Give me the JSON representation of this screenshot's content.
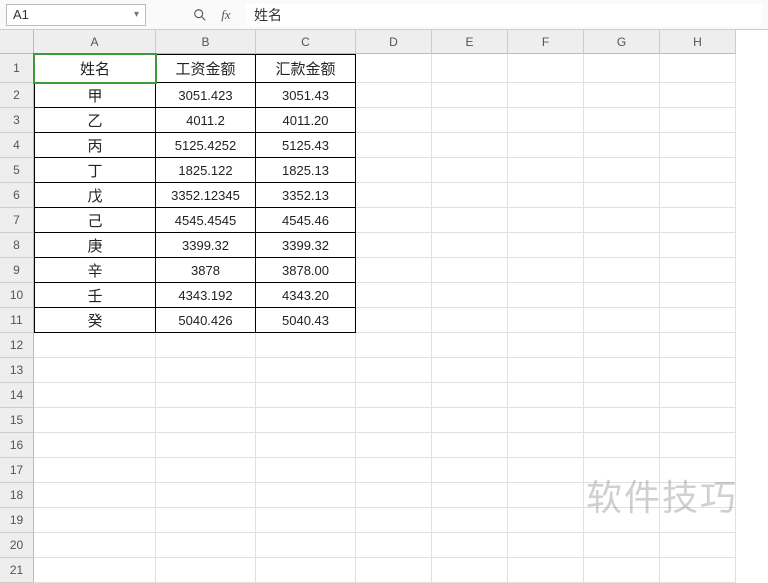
{
  "nameBox": "A1",
  "formula": "姓名",
  "columns": [
    "A",
    "B",
    "C",
    "D",
    "E",
    "F",
    "G",
    "H"
  ],
  "rowCount": 21,
  "activeCell": {
    "row": 1,
    "col": 0
  },
  "headers": [
    "姓名",
    "工资金额",
    "汇款金额"
  ],
  "table": [
    {
      "name": "甲",
      "salary": "3051.423",
      "remit": "3051.43"
    },
    {
      "name": "乙",
      "salary": "4011.2",
      "remit": "4011.20"
    },
    {
      "name": "丙",
      "salary": "5125.4252",
      "remit": "5125.43"
    },
    {
      "name": "丁",
      "salary": "1825.122",
      "remit": "1825.13"
    },
    {
      "name": "戊",
      "salary": "3352.12345",
      "remit": "3352.13"
    },
    {
      "name": "己",
      "salary": "4545.4545",
      "remit": "4545.46"
    },
    {
      "name": "庚",
      "salary": "3399.32",
      "remit": "3399.32"
    },
    {
      "name": "辛",
      "salary": "3878",
      "remit": "3878.00"
    },
    {
      "name": "壬",
      "salary": "4343.192",
      "remit": "4343.20"
    },
    {
      "name": "癸",
      "salary": "5040.426",
      "remit": "5040.43"
    }
  ],
  "watermark": "软件技巧"
}
